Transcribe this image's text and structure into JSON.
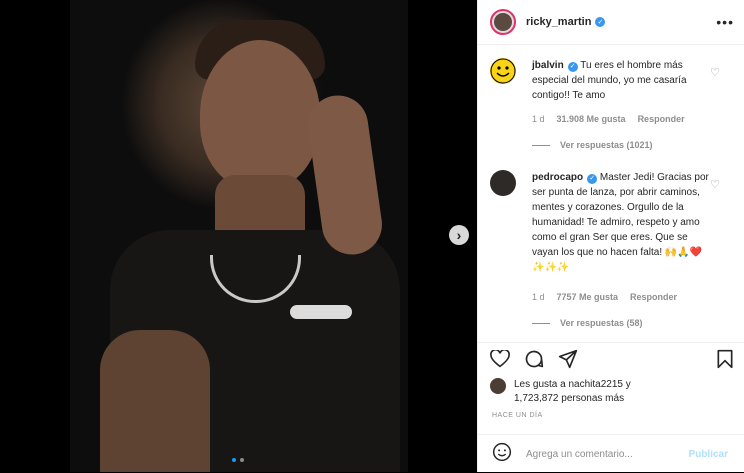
{
  "post": {
    "username": "ricky_martin",
    "more_icon": "more-horizontal-icon",
    "carousel": {
      "current": 1,
      "total": 2
    }
  },
  "comments": [
    {
      "username": "jbalvin",
      "text": "Tu eres el hombre más especial del mundo, yo me casaría contigo!! Te amo",
      "time": "1 d",
      "likes": "31.908 Me gusta",
      "reply_label": "Responder",
      "view_replies": "Ver respuestas (1021)"
    },
    {
      "username": "pedrocapo",
      "text": "Master Jedi! Gracias por ser punta de lanza, por abrir caminos, mentes y corazones. Orgullo de la humanidad! Te admiro, respeto y amo como el gran Ser que eres. Que se vayan los que no hacen falta! 🙌🙏❤️✨✨✨",
      "time": "1 d",
      "likes": "7757 Me gusta",
      "reply_label": "Responder",
      "view_replies": "Ver respuestas (58)"
    }
  ],
  "likes": {
    "line1": "Les gusta a nachita2215 y",
    "line2": "1,723,872 personas más"
  },
  "timestamp": "HACE UN DÍA",
  "add_comment": {
    "placeholder": "Agrega un comentario...",
    "publish_label": "Publicar"
  },
  "colors": {
    "verified": "#3897f0",
    "text": "#262626",
    "muted": "#8e8e8e",
    "publish_disabled": "#b2dffc"
  }
}
